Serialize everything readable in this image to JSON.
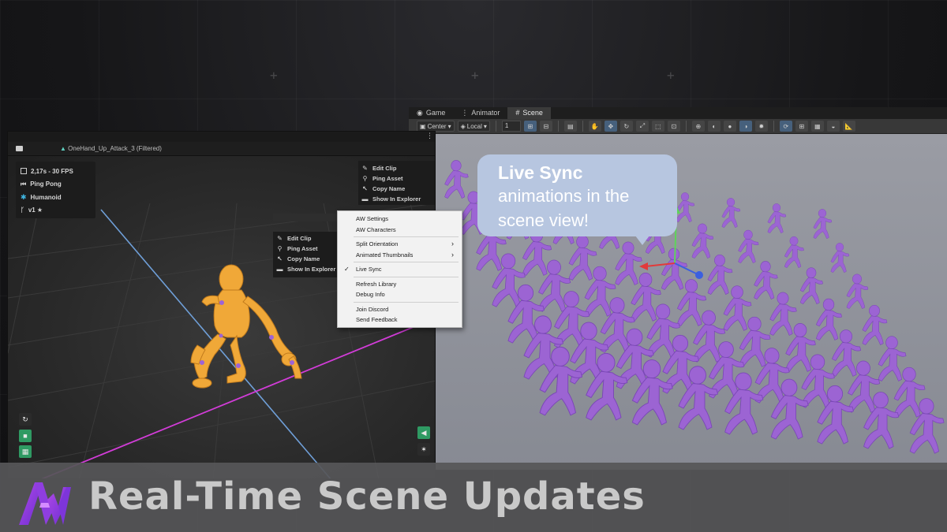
{
  "scene_window": {
    "tabs": [
      {
        "label": "Game",
        "icon": "gamepad-icon"
      },
      {
        "label": "Animator",
        "icon": "animator-icon"
      },
      {
        "label": "Scene",
        "icon": "grid-icon"
      }
    ],
    "toolbar": {
      "pivot_mode": "Center",
      "space_mode": "Local",
      "grid_value": "1"
    },
    "callout": {
      "title": "Live Sync",
      "body": "animations in the scene view!"
    }
  },
  "preview_window": {
    "title": "OneHand_Up_Attack_3 (Filtered)",
    "info": {
      "duration": "2,17s - 30 FPS",
      "loop_mode": "Ping Pong",
      "rig": "Humanoid",
      "version": "v1 ★"
    },
    "context_panel_a": [
      "Edit Clip",
      "Ping Asset",
      "Copy Name",
      "Show In Explorer"
    ],
    "context_panel_b": [
      "Edit Clip",
      "Ping Asset",
      "Copy Name",
      "Show In Explorer"
    ]
  },
  "dropdown_menu": {
    "items": [
      {
        "label": "AW Settings",
        "checked": false,
        "submenu": false
      },
      {
        "label": "AW Characters",
        "checked": false,
        "submenu": false
      },
      {
        "label": "Split Orientation",
        "checked": false,
        "submenu": true
      },
      {
        "label": "Animated Thumbnails",
        "checked": false,
        "submenu": true
      },
      {
        "label": "Live Sync",
        "checked": true,
        "submenu": false
      },
      {
        "label": "Refresh Library",
        "checked": false,
        "submenu": false
      },
      {
        "label": "Debug Info",
        "checked": false,
        "submenu": false
      },
      {
        "label": "Join Discord",
        "checked": false,
        "submenu": false
      },
      {
        "label": "Send Feedback",
        "checked": false,
        "submenu": false
      }
    ]
  },
  "banner": {
    "title": "Real-Time Scene Updates"
  },
  "colors": {
    "character_orange": "#f0a838",
    "character_purple": "#9d63d6",
    "accent_green": "#2f9a63",
    "grid_pink": "#d23cd8",
    "grid_blue": "#6f9fd8"
  }
}
